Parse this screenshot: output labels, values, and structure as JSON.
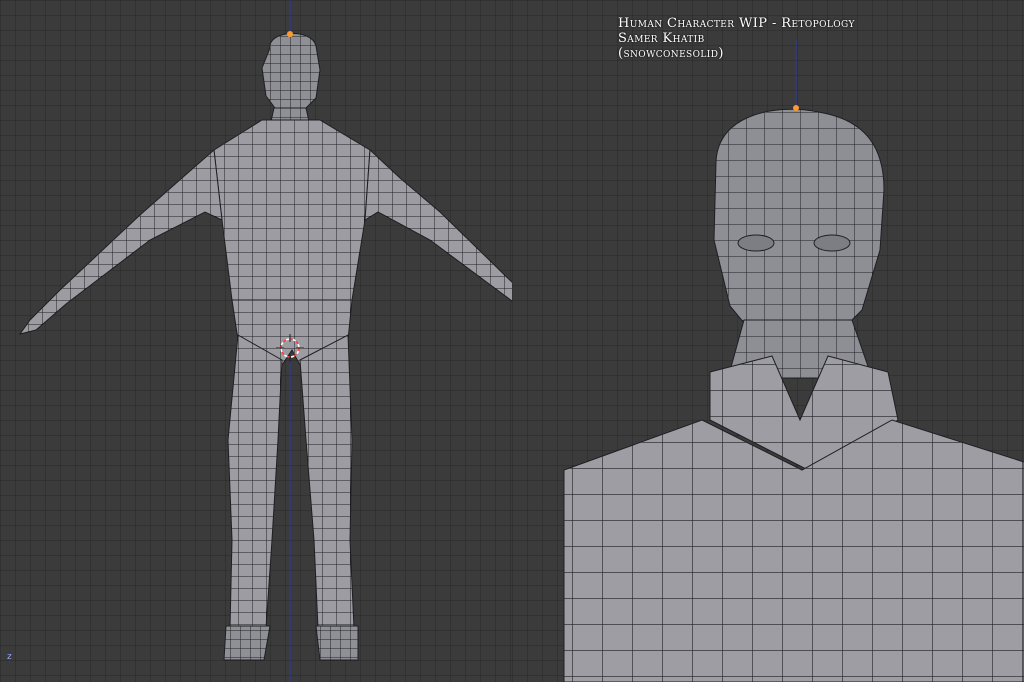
{
  "title": {
    "line1": "Human Character WIP - Retopology",
    "line2": "Samer Khatib",
    "line3": "(snowconesolid)"
  },
  "viewport": {
    "axis_label": "z"
  },
  "colors": {
    "background": "#3b3b3b",
    "mesh_fill": "#9b9ba1",
    "mesh_edge": "#222226",
    "z_axis": "#2d3aa6",
    "origin_dot": "#ff9a2e",
    "cursor": "#ff3b3b"
  },
  "icons": {
    "cursor": "3d-cursor-icon",
    "origin": "object-origin-icon"
  }
}
